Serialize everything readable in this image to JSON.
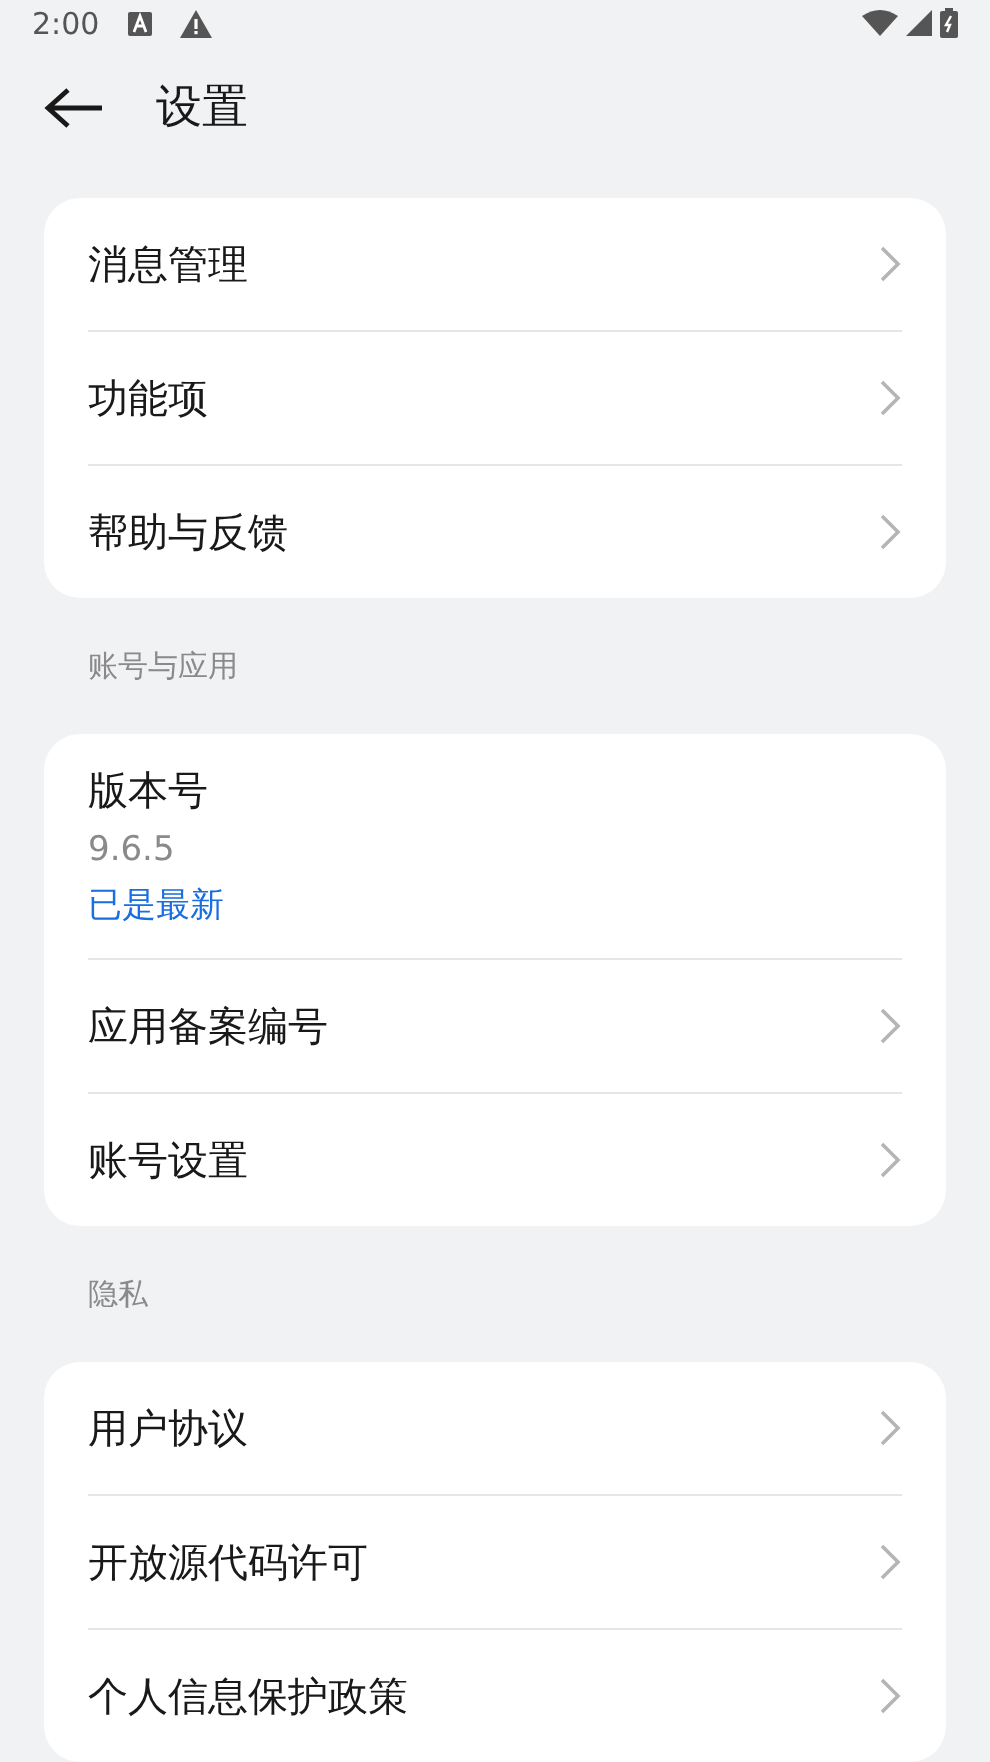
{
  "status_bar": {
    "time": "2:00"
  },
  "header": {
    "title": "设置"
  },
  "sections": [
    {
      "items": [
        {
          "label": "消息管理"
        },
        {
          "label": "功能项"
        },
        {
          "label": "帮助与反馈"
        }
      ]
    },
    {
      "title": "账号与应用",
      "items": [
        {
          "kind": "info",
          "label": "版本号",
          "value": "9.6.5",
          "note": "已是最新"
        },
        {
          "kind": "link",
          "label": "应用备案编号"
        },
        {
          "kind": "link",
          "label": "账号设置"
        }
      ]
    },
    {
      "title": "隐私",
      "items": [
        {
          "label": "用户协议"
        },
        {
          "label": "开放源代码许可"
        },
        {
          "label": "个人信息保护政策"
        }
      ]
    }
  ]
}
